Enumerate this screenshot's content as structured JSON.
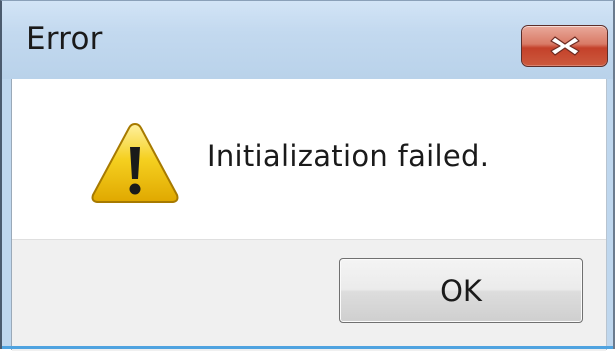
{
  "dialog": {
    "title": "Error",
    "message": "Initialization failed.",
    "ok_label": "OK",
    "icons": {
      "close": "close-icon",
      "warning": "warning-icon"
    }
  },
  "colors": {
    "titlebar": "#c3d9ef",
    "close_button": "#c4412a",
    "warning_fill": "#f2c300",
    "footer": "#f0f0f0",
    "accent": "#4fa3e0"
  }
}
